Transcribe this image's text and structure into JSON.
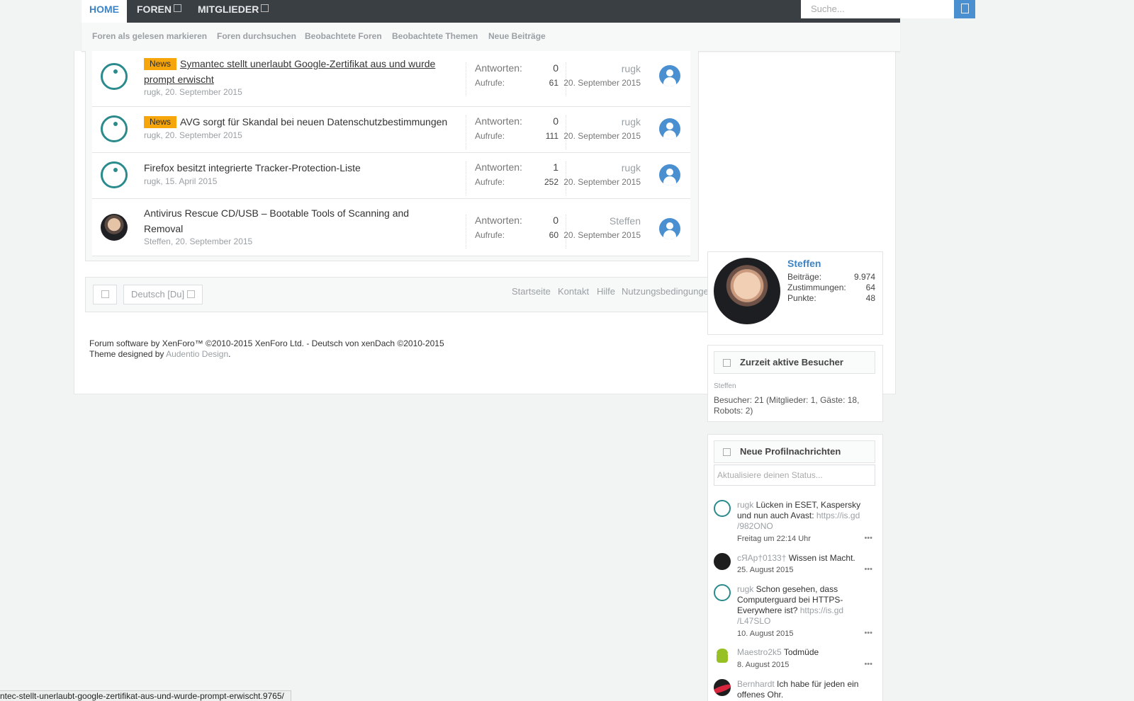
{
  "nav": {
    "tabs": [
      {
        "label": "HOME"
      },
      {
        "label": "FOREN"
      },
      {
        "label": "MITGLIEDER"
      }
    ],
    "search_placeholder": "Suche..."
  },
  "subnav": {
    "links": [
      "Foren als gelesen markieren",
      "Foren durchsuchen",
      "Beobachtete Foren",
      "Beobachtete Themen",
      "Neue Beiträge"
    ]
  },
  "threads": [
    {
      "badge": "News",
      "title_line1": "Symantec stellt unerlaubt Google-Zertifikat aus und wurde",
      "title_line2": "prompt erwischt",
      "author": "rugk",
      "date": ", 20. September 2015",
      "replies_label": "Antworten:",
      "replies": "0",
      "views_label": "Aufrufe:",
      "views": "61",
      "last_user": "rugk",
      "last_date": "20. September 2015"
    },
    {
      "badge": "News",
      "title_line1": "AVG sorgt für Skandal bei neuen Datenschutzbestimmungen",
      "author": "rugk",
      "date": ", 20. September 2015",
      "replies_label": "Antworten:",
      "replies": "0",
      "views_label": "Aufrufe:",
      "views": "111",
      "last_user": "rugk",
      "last_date": "20. September 2015"
    },
    {
      "title_line1": "Firefox besitzt integrierte Tracker-Protection-Liste",
      "author": "rugk",
      "date": ", 15. April 2015",
      "replies_label": "Antworten:",
      "replies": "1",
      "views_label": "Aufrufe:",
      "views": "252",
      "last_user": "rugk",
      "last_date": "20. September 2015"
    },
    {
      "title_line1": "Antivirus Rescue CD/USB – Bootable Tools of Scanning and",
      "title_line2": "Removal",
      "author": "Steffen",
      "date": ", 20. September 2015",
      "replies_label": "Antworten:",
      "replies": "0",
      "views_label": "Aufrufe:",
      "views": "60",
      "last_user": "Steffen",
      "last_date": "20. September 2015"
    }
  ],
  "footer": {
    "language": "Deutsch [Du]",
    "links": [
      "Startseite",
      "Kontakt",
      "Hilfe",
      "Nutzungsbedingungen"
    ],
    "copyright_line1": "Forum software by XenForo™ ©2010-2015 XenForo Ltd. - Deutsch von xenDach ©2010-2015",
    "copyright_line2_prefix": "Theme designed by ",
    "copyright_line2_link": "Audentio Design",
    "copyright_line2_suffix": "."
  },
  "visitor": {
    "name": "Steffen",
    "stats": [
      {
        "label": "Beiträge:",
        "value": "9.974"
      },
      {
        "label": "Zustimmungen:",
        "value": "64"
      },
      {
        "label": "Punkte:",
        "value": "48"
      }
    ]
  },
  "online": {
    "title": "Zurzeit aktive Besucher",
    "members": "Steffen",
    "summary_line1": "Besucher: 21 (Mitglieder: 1, Gäste: 18,",
    "summary_line2": "Robots: 2)"
  },
  "profile_posts": {
    "title": "Neue Profilnachrichten",
    "status_placeholder": "Aktualisiere deinen Status...",
    "posts": [
      {
        "user": "rugk",
        "text": " Lücken in ESET, Kaspersky",
        "line2": "und nun auch Avast: ",
        "link": "https://is.gd",
        "line3": "/982ONO",
        "date": "Freitag um 22:14 Uhr"
      },
      {
        "user": "cЯAp†0133†",
        "text": " Wissen ist Macht.",
        "date": "25. August 2015"
      },
      {
        "user": "rugk",
        "text": " Schon gesehen, dass",
        "line2": "Computerguard bei HTTPS-",
        "line3a": "Everywhere ist? ",
        "link": "https://is.gd",
        "line4": "/L47SLO",
        "date": "10. August 2015"
      },
      {
        "user": "Maestro2k5",
        "text": " Todmüde",
        "date": "8. August 2015"
      },
      {
        "user": "Bernhardt",
        "text": " Ich habe für jeden ein",
        "line2": "offenes Ohr."
      }
    ],
    "more": "•••"
  },
  "status_bar": "ntec-stellt-unerlaubt-google-zertifikat-aus-und-wurde-prompt-erwischt.9765/"
}
